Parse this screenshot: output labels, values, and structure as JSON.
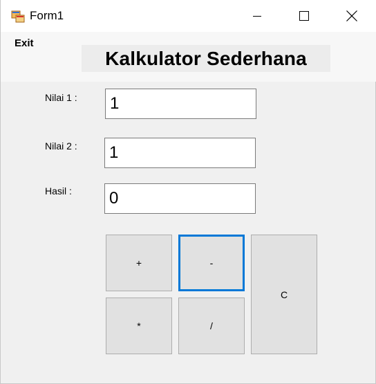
{
  "window": {
    "title": "Form1"
  },
  "menu": {
    "exit_label": "Exit"
  },
  "form": {
    "heading": "Kalkulator Sederhana",
    "nilai1_label": "Nilai 1 :",
    "nilai1_value": "1",
    "nilai2_label": "Nilai 2 :",
    "nilai2_value": "1",
    "hasil_label": "Hasil :",
    "hasil_value": "0"
  },
  "buttons": {
    "add": "+",
    "subtract": "-",
    "multiply": "*",
    "divide": "/",
    "clear": "C"
  },
  "colors": {
    "focus_border": "#0078d7",
    "form_background": "#f0f0f0",
    "button_face": "#e1e1e1"
  }
}
